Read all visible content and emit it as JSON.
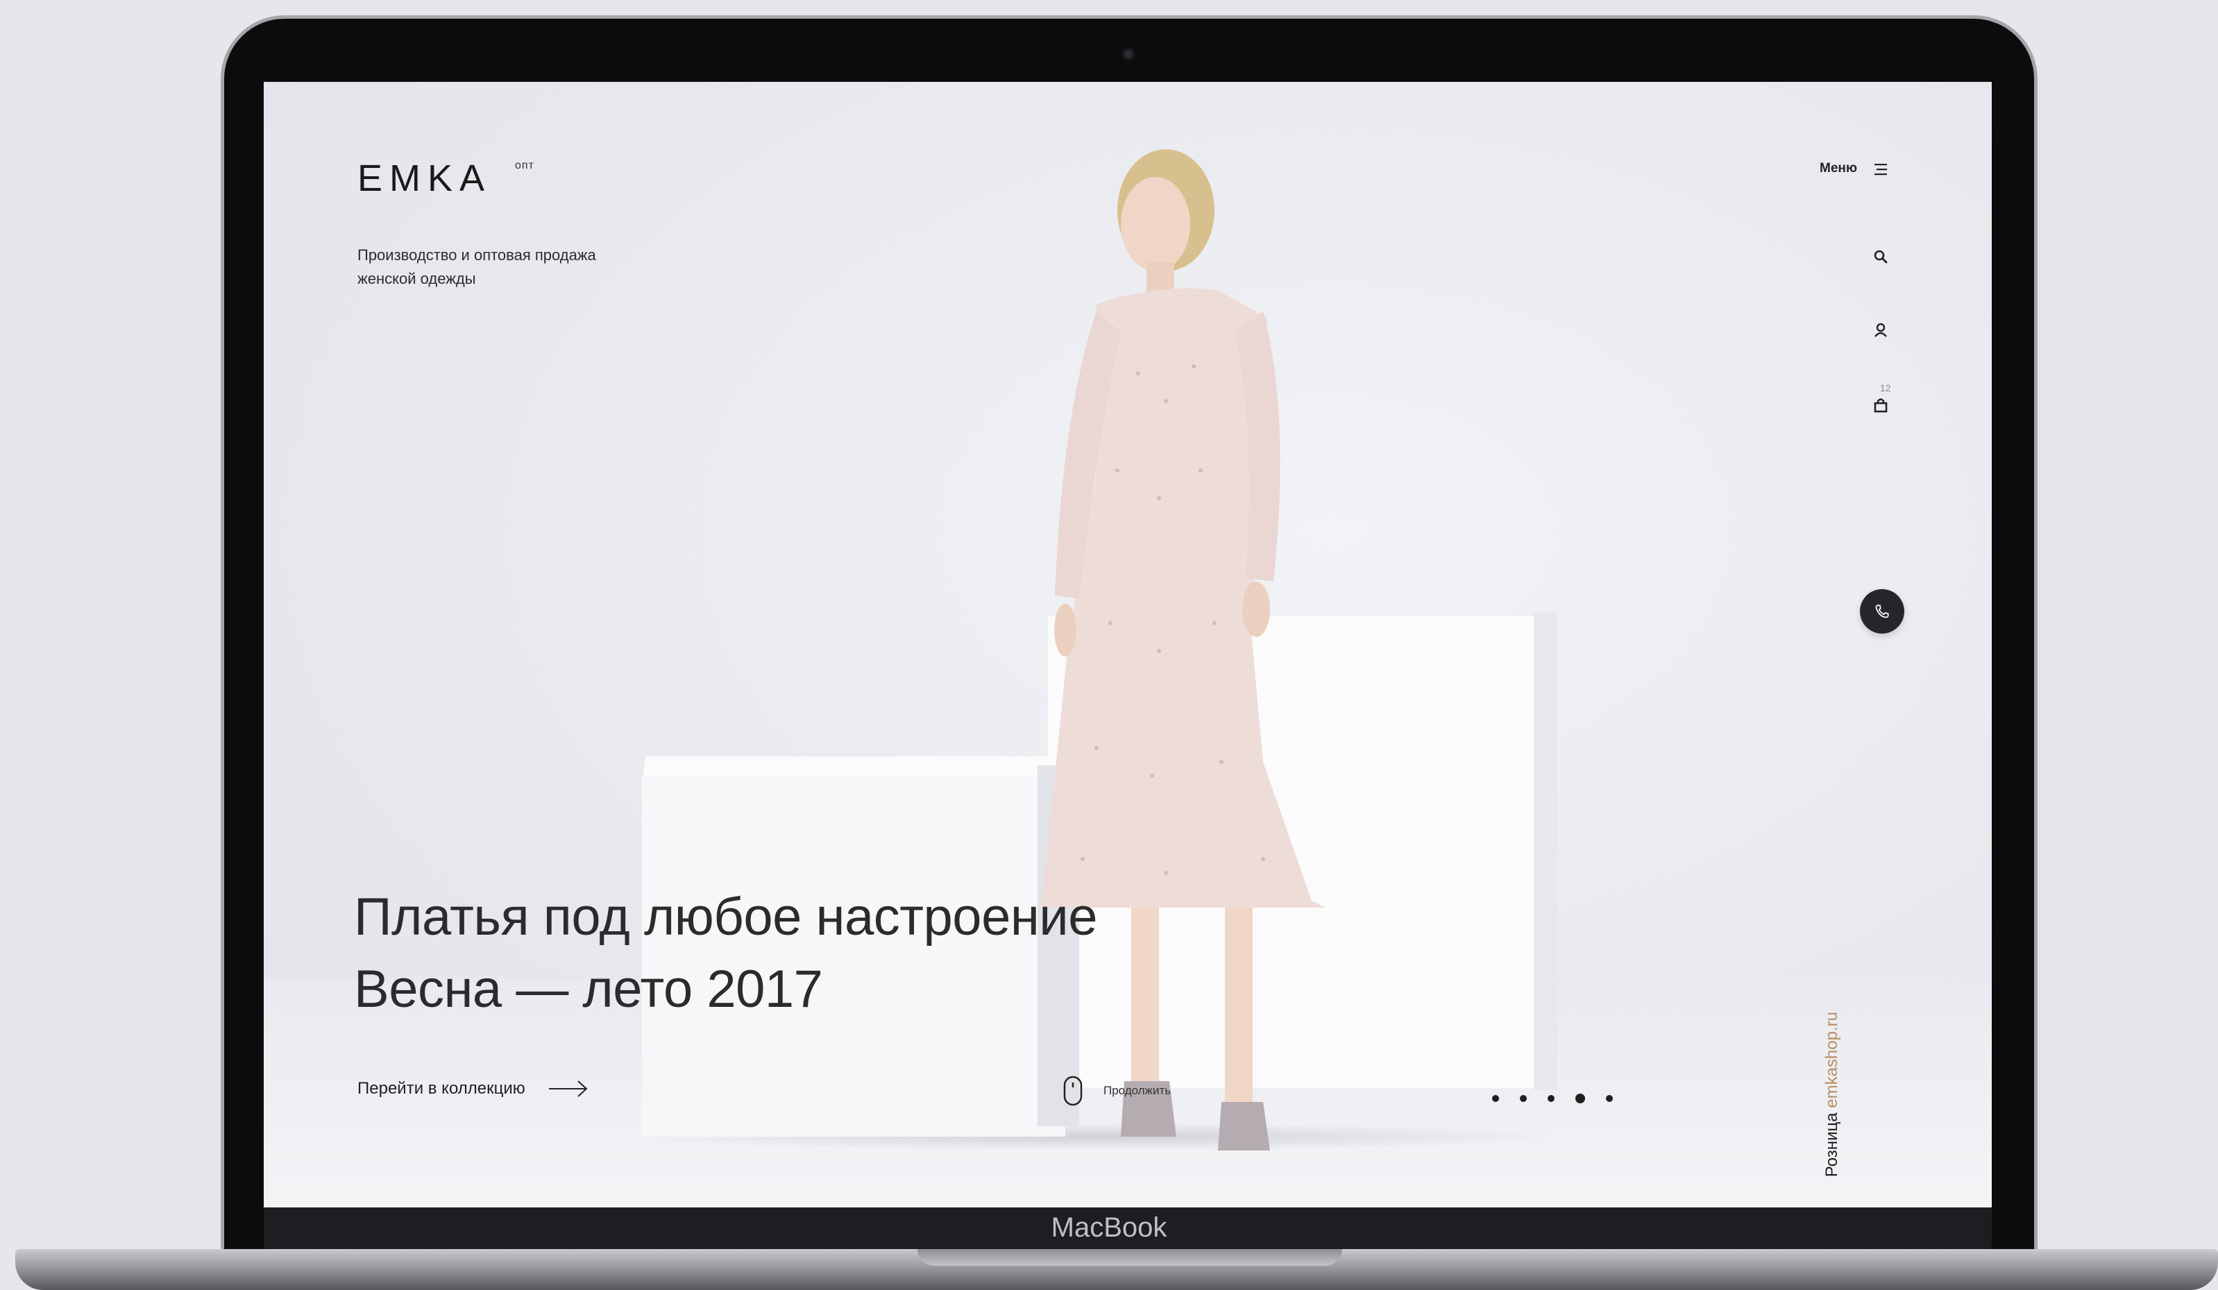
{
  "device": {
    "brand_label": "MacBook"
  },
  "header": {
    "logo": "EMKA",
    "logo_sup": "опт",
    "tagline": "Производство и оптовая продажа женской одежды",
    "menu_label": "Меню",
    "cart_count": "12"
  },
  "icons": {
    "menu": "hamburger-icon",
    "search": "search-icon",
    "account": "user-icon",
    "cart": "shopping-bag-icon",
    "call": "phone-icon",
    "cta": "arrow-right-icon",
    "scroll": "mouse-icon"
  },
  "hero": {
    "headline_line1": "Платья под любое настроение",
    "headline_line2": "Весна — лето 2017",
    "cta_label": "Перейти в коллекцию",
    "scroll_label": "Продолжить"
  },
  "slider": {
    "slide_count": 5,
    "active_index": 3
  },
  "retail": {
    "prefix": "Розница",
    "link": "emkashop.ru"
  },
  "colors": {
    "background": "#e9eaef",
    "text": "#1f1f1f",
    "accent_link": "#b98d63",
    "call_button": "#24262b"
  }
}
